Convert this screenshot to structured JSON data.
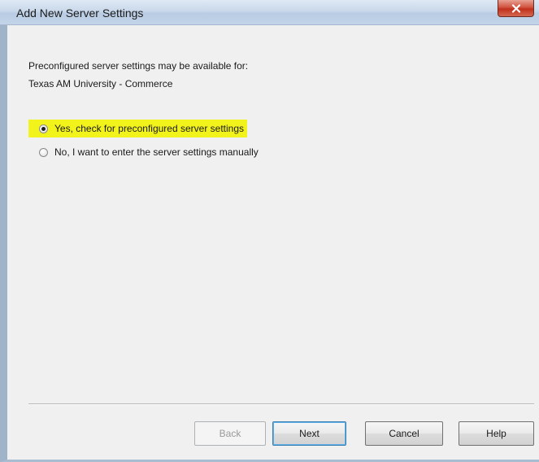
{
  "window": {
    "title": "Add New Server Settings"
  },
  "intro": {
    "line1": "Preconfigured server settings may be available for:",
    "line2": "Texas AM University - Commerce"
  },
  "options": [
    {
      "label": "Yes, check for preconfigured server settings",
      "selected": true,
      "highlight": "#f3f31c"
    },
    {
      "label": "No, I want to enter the server settings manually",
      "selected": false
    }
  ],
  "buttons": {
    "back": "Back",
    "next": "Next",
    "cancel": "Cancel",
    "help": "Help"
  },
  "icons": {
    "close": "close-icon"
  }
}
